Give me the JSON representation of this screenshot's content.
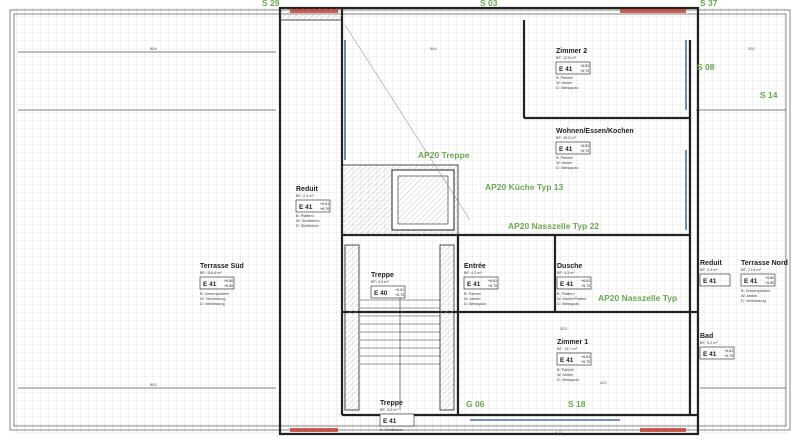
{
  "colors": {
    "wall": "#222222",
    "grid": "#cfcfcf",
    "hatch": "#e0e0e0",
    "accent_green": "#6aa84f",
    "brick": "#c0392b",
    "window": "#4a6fa5"
  },
  "labels": {
    "top_marks": [
      "S 29",
      "S 03",
      "S 37"
    ],
    "s08": "S 08",
    "s14": "S 14",
    "s18": "S 18",
    "g06": "G 06",
    "ap_treppe": "AP20 Treppe",
    "ap_kueche": "AP20 Küche Typ 13",
    "ap_nasszelle_22": "AP20 Nasszelle Typ 22",
    "ap_nasszelle_typ": "AP20 Nasszelle Typ"
  },
  "rooms": {
    "zimmer2": {
      "name": "Zimmer 2",
      "area": "BF: 12.5 m²",
      "code": "E 41",
      "v1": "+6.81",
      "v2": "+6.70",
      "b": "B: Parkett",
      "w": "W: Abrieb",
      "d": "D: Weissputz"
    },
    "wohnen": {
      "name": "Wohnen/Essen/Kochen",
      "area": "BF: 45.2 m²",
      "code": "E 41",
      "v1": "+6.81",
      "v2": "+6.70",
      "b": "B: Parkett",
      "w": "W: Abrieb",
      "d": "D: Weissputz"
    },
    "reduit_l": {
      "name": "Reduit",
      "area": "BF: 2.3 m²",
      "code": "E 41",
      "v1": "+6.81",
      "v2": "+6.70",
      "b": "B: Plattení",
      "w": "W: Sichtbeton",
      "d": "D: Sichtbeton"
    },
    "terrasse_s": {
      "name": "Terrasse Süd",
      "area": "BF: 116.6 m²",
      "code": "E 41",
      "v1": "+6.80",
      "v2": "+6.50",
      "b": "B: Zementplatten",
      "w": "W: Verkleidung",
      "d": "D: Verkleidung"
    },
    "entree": {
      "name": "Entrée",
      "area": "BF: 4.2 m²",
      "code": "E 41",
      "v1": "+6.81",
      "v2": "+6.70",
      "b": "B: Parkett",
      "w": "W: Abrieb",
      "d": "D: Weissputz"
    },
    "dusche": {
      "name": "Dusche",
      "area": "BF: 4.5 m²",
      "code": "E 41",
      "v1": "+6.81",
      "v2": "+6.70",
      "b": "B: Plattení",
      "w": "W: Abrieb/Platten",
      "d": "D: Weissputz"
    },
    "treppe_m": {
      "name": "Treppe",
      "area": "BF: 4.5 m²",
      "code": "E 40",
      "v1": "+6.81",
      "v2": "+6.70",
      "b": "B: Plattení",
      "w": "W: Sichtbeton",
      "d": "D: Sichtbeton"
    },
    "zimmer1": {
      "name": "Zimmer 1",
      "area": "BF: 13.7 m²",
      "code": "E 41",
      "v1": "+6.81",
      "v2": "+6.70",
      "b": "B: Parkett",
      "w": "W: Abrieb",
      "d": "D: Weissputz"
    },
    "treppe_b": {
      "name": "Treppe",
      "area": "BF: 3.5 m²",
      "code": "E 41",
      "b": "B: Sichtbeton"
    },
    "reduit_r": {
      "name": "Reduit",
      "area": "BF: 3.3 m²",
      "code": "E 41"
    },
    "terrasse_n": {
      "name": "Terrasse Nord",
      "area": "BF: 21.6 m²",
      "code": "E 41",
      "v1": "+6.80",
      "v2": "+6.50",
      "b": "B: Zementplatten",
      "w": "W: Abrieb",
      "d": "D: Verkleidung"
    },
    "bad": {
      "name": "Bad",
      "area": "BF: 5.2 m²",
      "code": "E 41",
      "v1": "+6.81",
      "v2": "+6.70"
    }
  },
  "dims": {
    "d1": "854",
    "d2": "544",
    "d3": "802",
    "d4": "323",
    "d5": "422",
    "d6": "202",
    "d7": "8.11"
  }
}
